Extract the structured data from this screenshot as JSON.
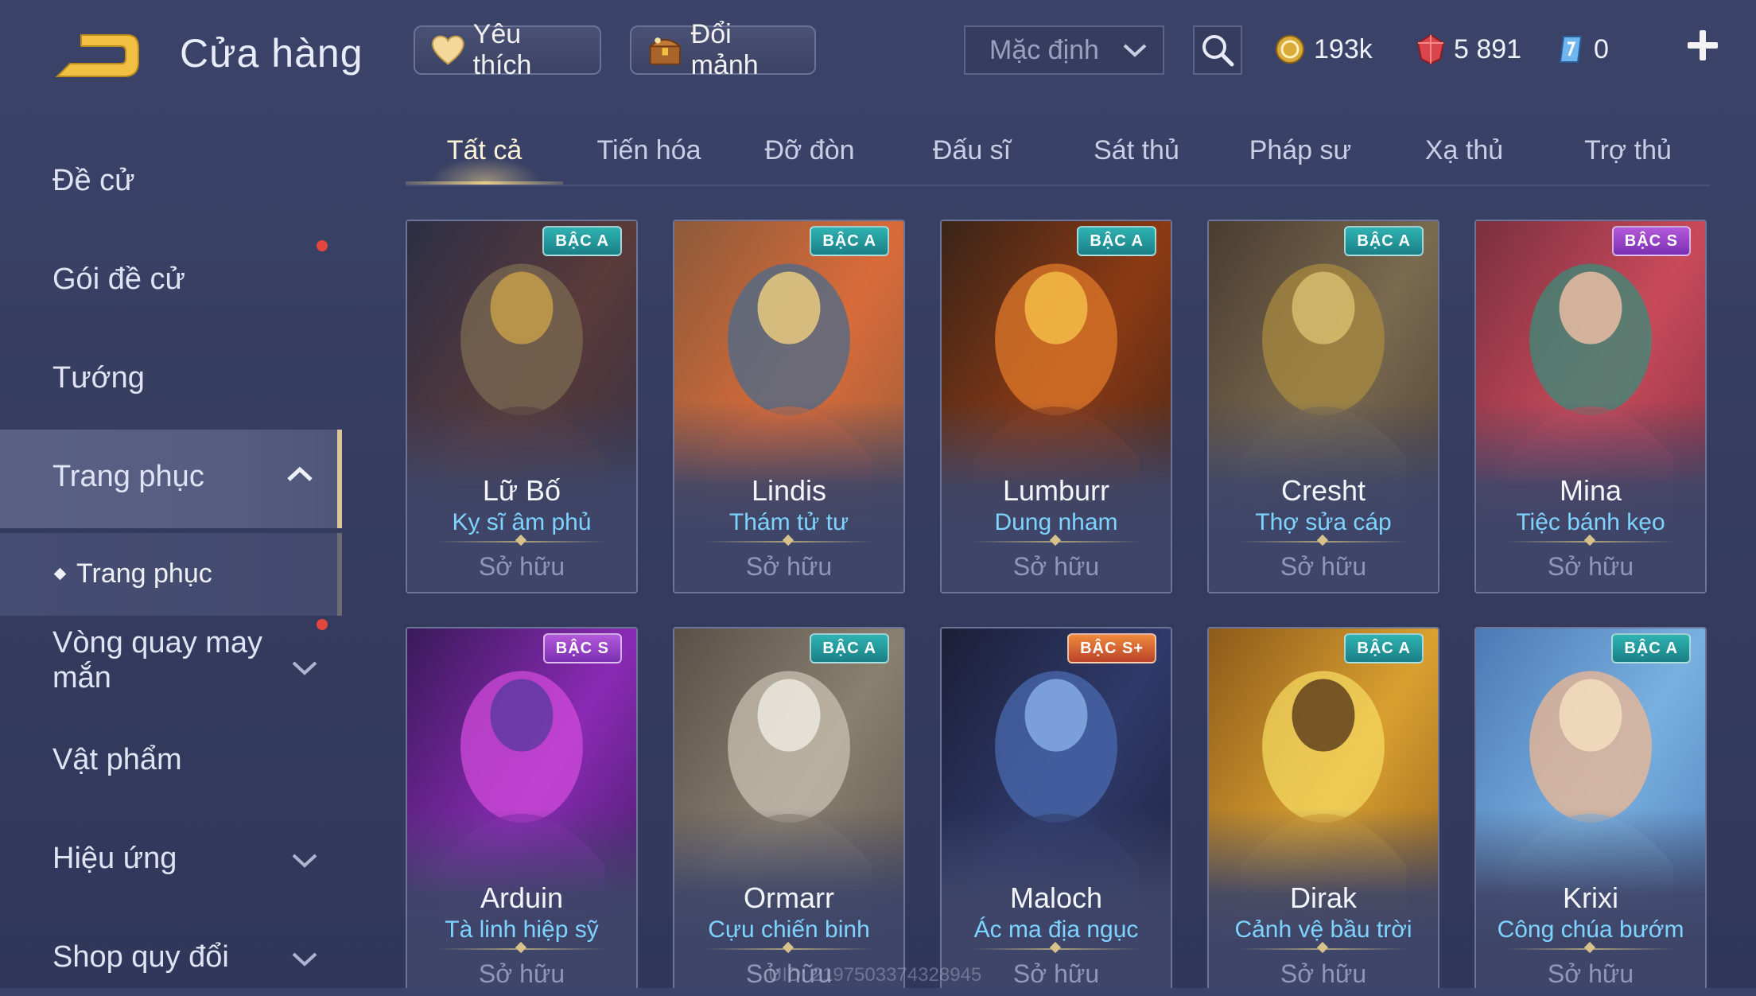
{
  "header": {
    "title": "Cửa hàng",
    "favorites_label": "Yêu thích",
    "shard_label": "Đổi mảnh",
    "sort_value": "Mặc định",
    "currencies": {
      "gold": "193k",
      "ruby": "5 891",
      "voucher": "0"
    }
  },
  "sidebar": {
    "items": [
      {
        "label": "Đề cử"
      },
      {
        "label": "Gói đề cử"
      },
      {
        "label": "Tướng"
      },
      {
        "label": "Trang phục"
      },
      {
        "label": "Vòng quay may mắn"
      },
      {
        "label": "Vật phẩm"
      },
      {
        "label": "Hiệu ứng"
      },
      {
        "label": "Shop quy đổi"
      }
    ],
    "sub_item": "Trang phục"
  },
  "tabs": [
    "Tất cả",
    "Tiến hóa",
    "Đỡ đòn",
    "Đấu sĩ",
    "Sát thủ",
    "Pháp sư",
    "Xạ thủ",
    "Trợ thủ"
  ],
  "cards": [
    {
      "hero": "Lữ Bố",
      "skin": "Kỵ sĩ âm phủ",
      "badge": "BẬC A",
      "status": "Sở hữu"
    },
    {
      "hero": "Lindis",
      "skin": "Thám tử tư",
      "badge": "BẬC A",
      "status": "Sở hữu"
    },
    {
      "hero": "Lumburr",
      "skin": "Dung nham",
      "badge": "BẬC A",
      "status": "Sở hữu"
    },
    {
      "hero": "Cresht",
      "skin": "Thợ sửa cáp",
      "badge": "BẬC A",
      "status": "Sở hữu"
    },
    {
      "hero": "Mina",
      "skin": "Tiệc bánh kẹo",
      "badge": "BẬC S",
      "status": "Sở hữu"
    },
    {
      "hero": "Arduin",
      "skin": "Tà linh hiệp sỹ",
      "badge": "BẬC S",
      "status": "Sở hữu"
    },
    {
      "hero": "Ormarr",
      "skin": "Cựu chiến binh",
      "badge": "BẬC A",
      "status": "Sở hữu"
    },
    {
      "hero": "Maloch",
      "skin": "Ác ma địa ngục",
      "badge": "BẬC S+",
      "status": "Sở hữu"
    },
    {
      "hero": "Dirak",
      "skin": "Cảnh vệ bầu trời",
      "badge": "BẬC A",
      "status": "Sở hữu"
    },
    {
      "hero": "Krixi",
      "skin": "Công chúa bướm",
      "badge": "BẬC A",
      "status": "Sở hữu"
    }
  ],
  "footer": {
    "uid": "UID: 2197503374328945"
  },
  "colors": {
    "accent_gold": "#e8cd8c",
    "skin_text": "#7fd3ff",
    "badge_a": "#2fb3b2",
    "badge_s": "#b35ad9",
    "badge_splus": "#f08a3c",
    "notification": "#e2463d"
  }
}
